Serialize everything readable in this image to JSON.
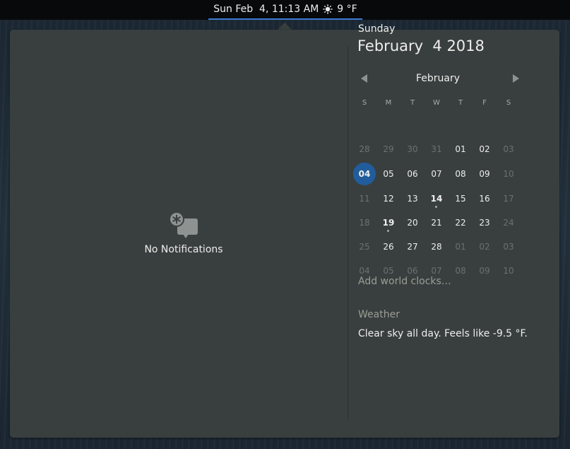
{
  "topbar": {
    "clock_day": "Sun Feb  4, 11:13 AM",
    "weather_icon": "sun-icon",
    "temperature": "9 °F"
  },
  "notifications": {
    "icon": "no-notifications-icon",
    "empty_label": "No Notifications"
  },
  "date": {
    "day_name": "Sunday",
    "full_date": "February  4 2018"
  },
  "calendar": {
    "month": "February",
    "weekdays": [
      "S",
      "M",
      "T",
      "W",
      "T",
      "F",
      "S"
    ],
    "weeks": [
      [
        {
          "d": "28",
          "dim": true
        },
        {
          "d": "29",
          "dim": true
        },
        {
          "d": "30",
          "dim": true
        },
        {
          "d": "31",
          "dim": true
        },
        {
          "d": "01"
        },
        {
          "d": "02"
        },
        {
          "d": "03",
          "dim": true
        }
      ],
      [
        {
          "d": "04",
          "today": true
        },
        {
          "d": "05"
        },
        {
          "d": "06"
        },
        {
          "d": "07"
        },
        {
          "d": "08"
        },
        {
          "d": "09"
        },
        {
          "d": "10",
          "dim": true
        }
      ],
      [
        {
          "d": "11",
          "dim": true
        },
        {
          "d": "12"
        },
        {
          "d": "13"
        },
        {
          "d": "14",
          "event": true
        },
        {
          "d": "15"
        },
        {
          "d": "16"
        },
        {
          "d": "17",
          "dim": true
        }
      ],
      [
        {
          "d": "18",
          "dim": true
        },
        {
          "d": "19",
          "event": true
        },
        {
          "d": "20"
        },
        {
          "d": "21"
        },
        {
          "d": "22"
        },
        {
          "d": "23"
        },
        {
          "d": "24",
          "dim": true
        }
      ],
      [
        {
          "d": "25",
          "dim": true
        },
        {
          "d": "26"
        },
        {
          "d": "27"
        },
        {
          "d": "28"
        },
        {
          "d": "01",
          "dim": true
        },
        {
          "d": "02",
          "dim": true
        },
        {
          "d": "03",
          "dim": true
        }
      ],
      [
        {
          "d": "04",
          "dim": true
        },
        {
          "d": "05",
          "dim": true
        },
        {
          "d": "06",
          "dim": true
        },
        {
          "d": "07",
          "dim": true
        },
        {
          "d": "08",
          "dim": true
        },
        {
          "d": "09",
          "dim": true
        },
        {
          "d": "10",
          "dim": true
        }
      ]
    ]
  },
  "world_clocks": {
    "label": "Add world clocks…"
  },
  "weather": {
    "title": "Weather",
    "summary": "Clear sky all day. Feels like -9.5 °F."
  },
  "colors": {
    "accent": "#215d9c",
    "topbar_underline": "#3a7bd0",
    "popover_bg": "#393f3f"
  }
}
